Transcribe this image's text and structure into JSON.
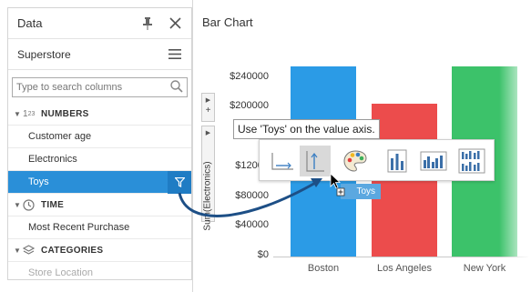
{
  "data_panel": {
    "title": "Data",
    "source": "Superstore",
    "search_placeholder": "Type to search columns",
    "groups": {
      "numbers": {
        "label": "NUMBERS",
        "items": [
          "Customer age",
          "Electronics",
          "Toys"
        ]
      },
      "time": {
        "label": "TIME",
        "items": [
          "Most Recent Purchase"
        ]
      },
      "categories": {
        "label": "CATEGORIES",
        "items": [
          "Store Location"
        ]
      }
    },
    "selected_item": "Toys"
  },
  "chart": {
    "title": "Bar Chart",
    "shelf_label": "Sum(Electronics)",
    "tooltip": "Use 'Toys' on the value axis.",
    "drag_label": "Toys"
  },
  "chart_data": {
    "type": "bar",
    "categories": [
      "Boston",
      "Los Angeles",
      "New York"
    ],
    "values": [
      255000,
      205000,
      255000
    ],
    "colors": [
      "#2b9be6",
      "#ec4c4c",
      "#3cc26a"
    ],
    "yticks": [
      "$0",
      "$40000",
      "$80000",
      "$12000",
      "$",
      "$200000",
      "$240000"
    ],
    "ylim": [
      0,
      280000
    ]
  }
}
